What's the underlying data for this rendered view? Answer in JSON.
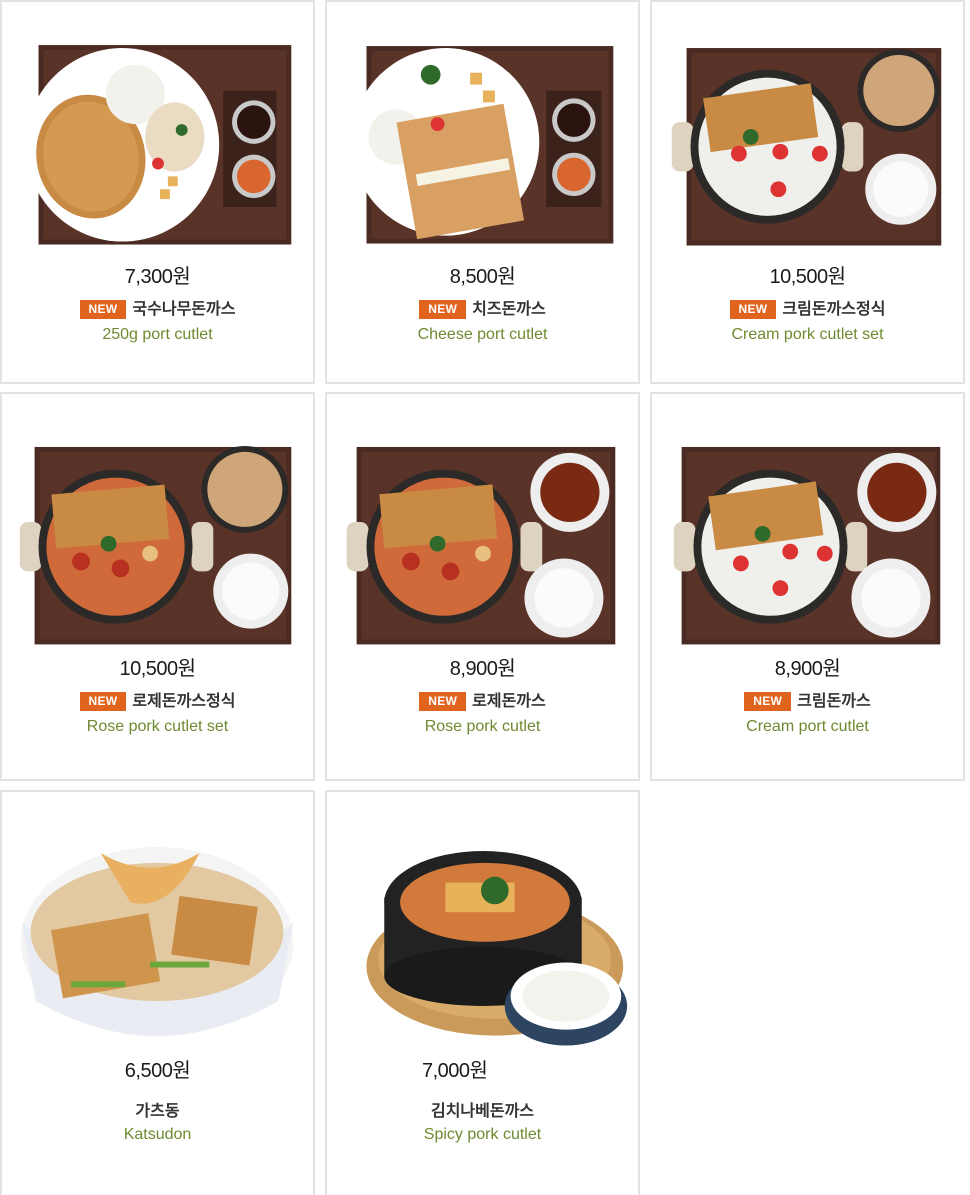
{
  "menu": [
    {
      "price": "7,300원",
      "badge": "NEW",
      "name": "국수나무돈까스",
      "en": "250g port cutlet",
      "kind": "plate"
    },
    {
      "price": "8,500원",
      "badge": "NEW",
      "name": "치즈돈까스",
      "en": "Cheese port cutlet",
      "kind": "plate-cheese"
    },
    {
      "price": "10,500원",
      "badge": "NEW",
      "name": "크림돈까스정식",
      "en": "Cream pork cutlet set",
      "kind": "pan-cream-set"
    },
    {
      "price": "10,500원",
      "badge": "NEW",
      "name": "로제돈까스정식",
      "en": "Rose pork cutlet set",
      "kind": "pan-rose-set"
    },
    {
      "price": "8,900원",
      "badge": "NEW",
      "name": "로제돈까스",
      "en": "Rose pork cutlet",
      "kind": "pan-rose"
    },
    {
      "price": "8,900원",
      "badge": "NEW",
      "name": "크림돈까스",
      "en": "Cream port cutlet",
      "kind": "pan-cream"
    },
    {
      "price": "6,500원",
      "badge": "",
      "name": "가츠동",
      "en": "Katsudon",
      "kind": "bowl"
    },
    {
      "price": "7,000원",
      "badge": "",
      "name": "김치나베돈까스",
      "en": "Spicy pork cutlet",
      "kind": "pot"
    }
  ],
  "colors": {
    "badge": "#e0641e",
    "english": "#6e8a30",
    "tray": "#4a2a22",
    "border": "#e3e3e3"
  }
}
